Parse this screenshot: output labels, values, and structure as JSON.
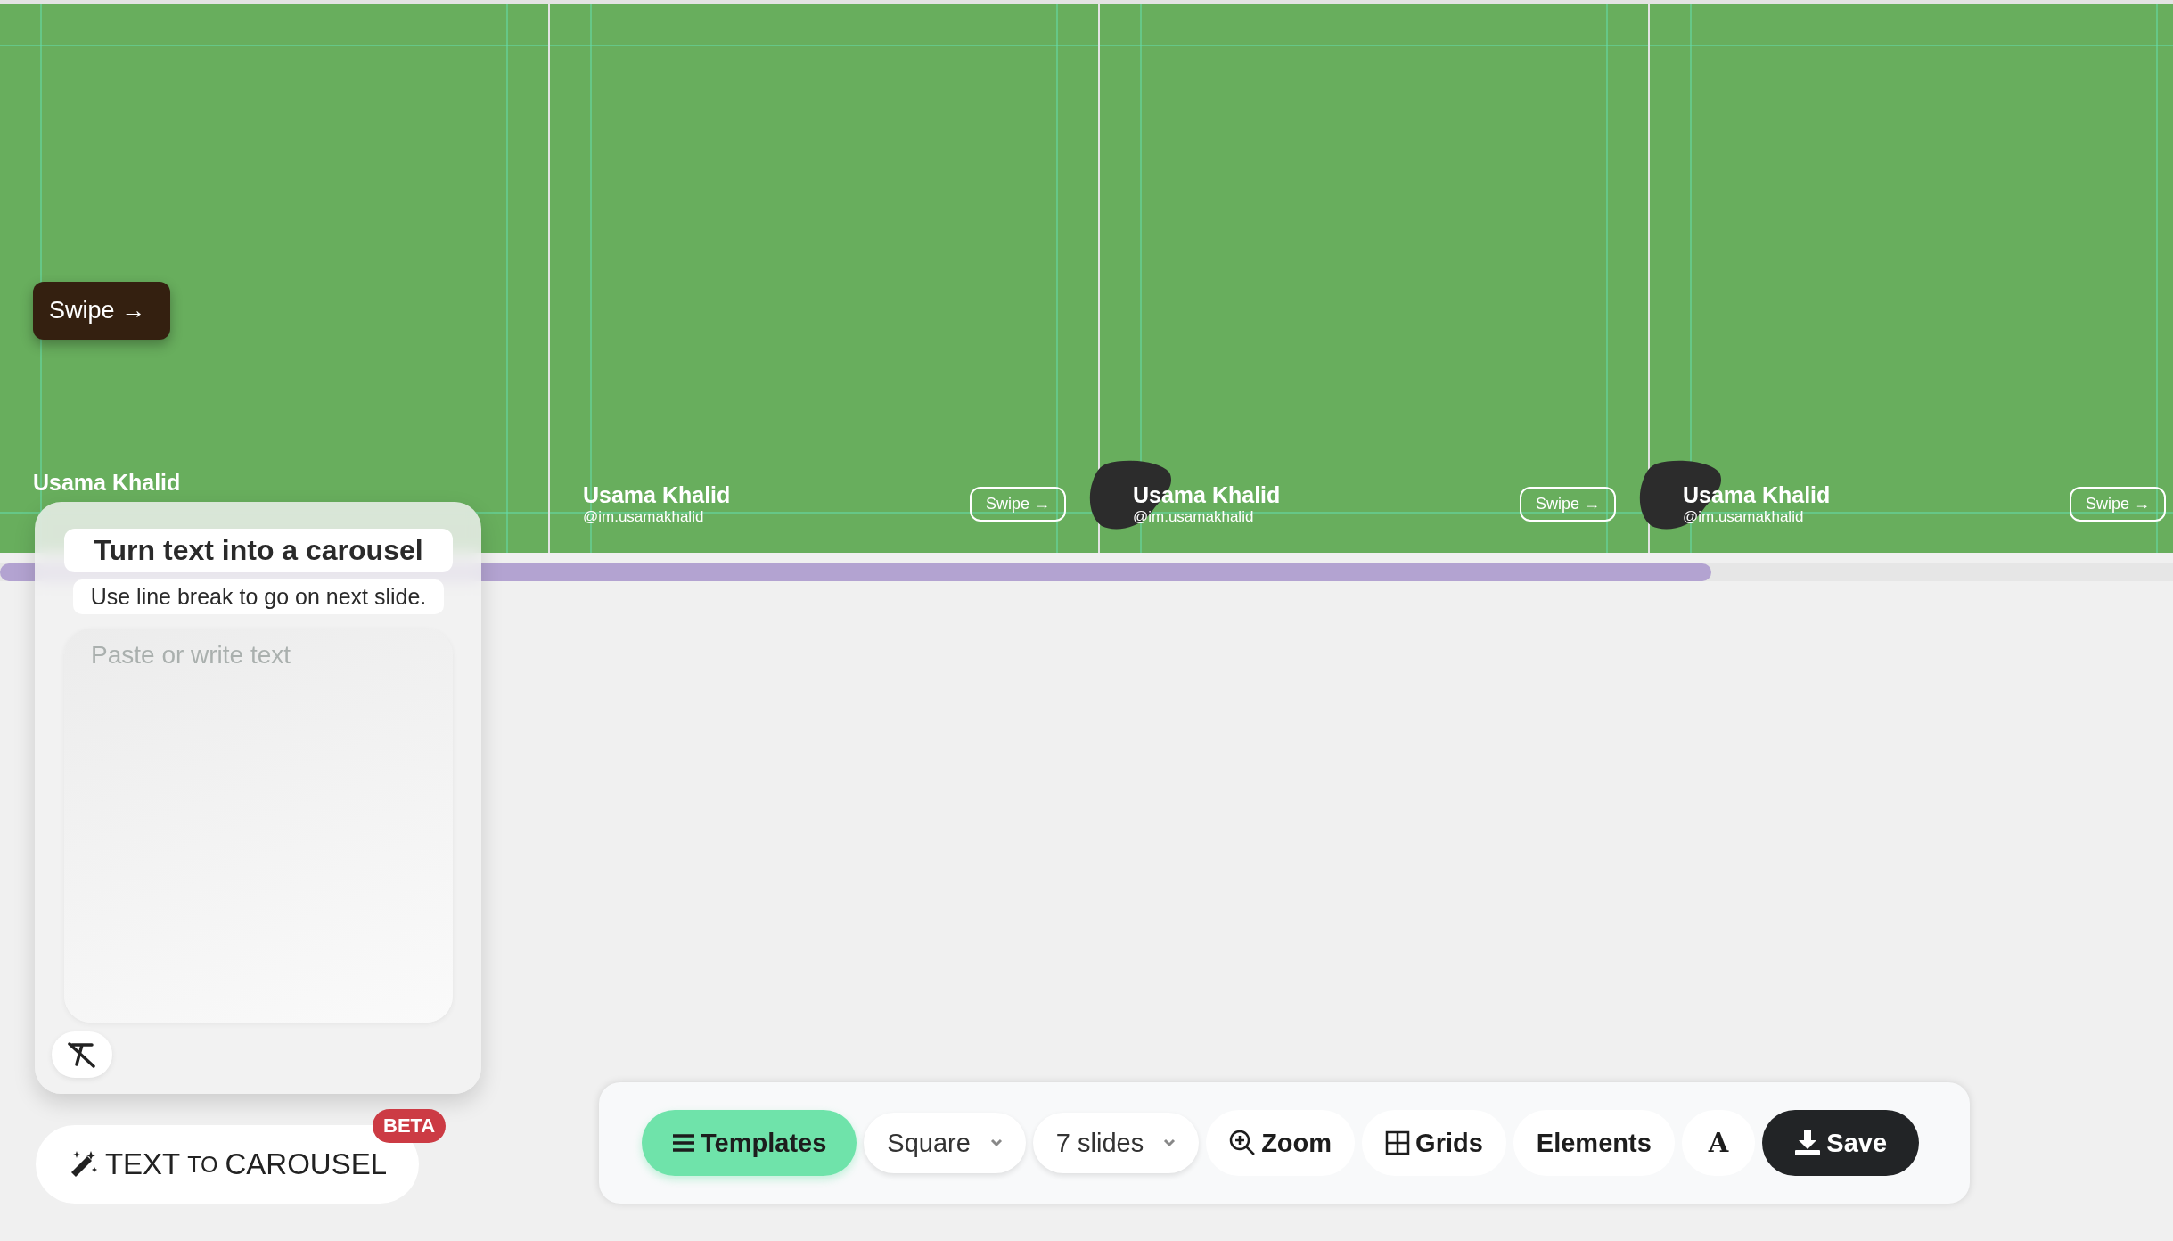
{
  "slides": [
    {
      "kind": "first",
      "name": "Usama Khalid",
      "swipe": "Swipe →",
      "blob": false
    },
    {
      "kind": "content",
      "name": "Usama Khalid",
      "handle": "@im.usamakhalid",
      "swipe": "Swipe →",
      "blob": false
    },
    {
      "kind": "content",
      "name": "Usama Khalid",
      "handle": "@im.usamakhalid",
      "swipe": "Swipe →",
      "blob": true
    },
    {
      "kind": "content",
      "name": "Usama Khalid",
      "handle": "@im.usamakhalid",
      "swipe": "Swipe →",
      "blob": true
    }
  ],
  "panel": {
    "title": "Turn text into a carousel",
    "hint": "Use line break to go on next slide.",
    "placeholder": "Paste or write text"
  },
  "generate_button": {
    "parts": [
      "TEXT",
      "TO",
      "CAROUSEL"
    ],
    "badge": "BETA"
  },
  "toolbar": [
    {
      "kind": "templates",
      "label": "Templates"
    },
    {
      "kind": "select",
      "label": "Square"
    },
    {
      "kind": "select",
      "label": "7 slides"
    },
    {
      "kind": "zoom",
      "label": "Zoom"
    },
    {
      "kind": "grids",
      "label": "Grids"
    },
    {
      "kind": "plain",
      "label": "Elements"
    },
    {
      "kind": "font",
      "label": "A"
    },
    {
      "kind": "save",
      "label": "Save"
    }
  ]
}
